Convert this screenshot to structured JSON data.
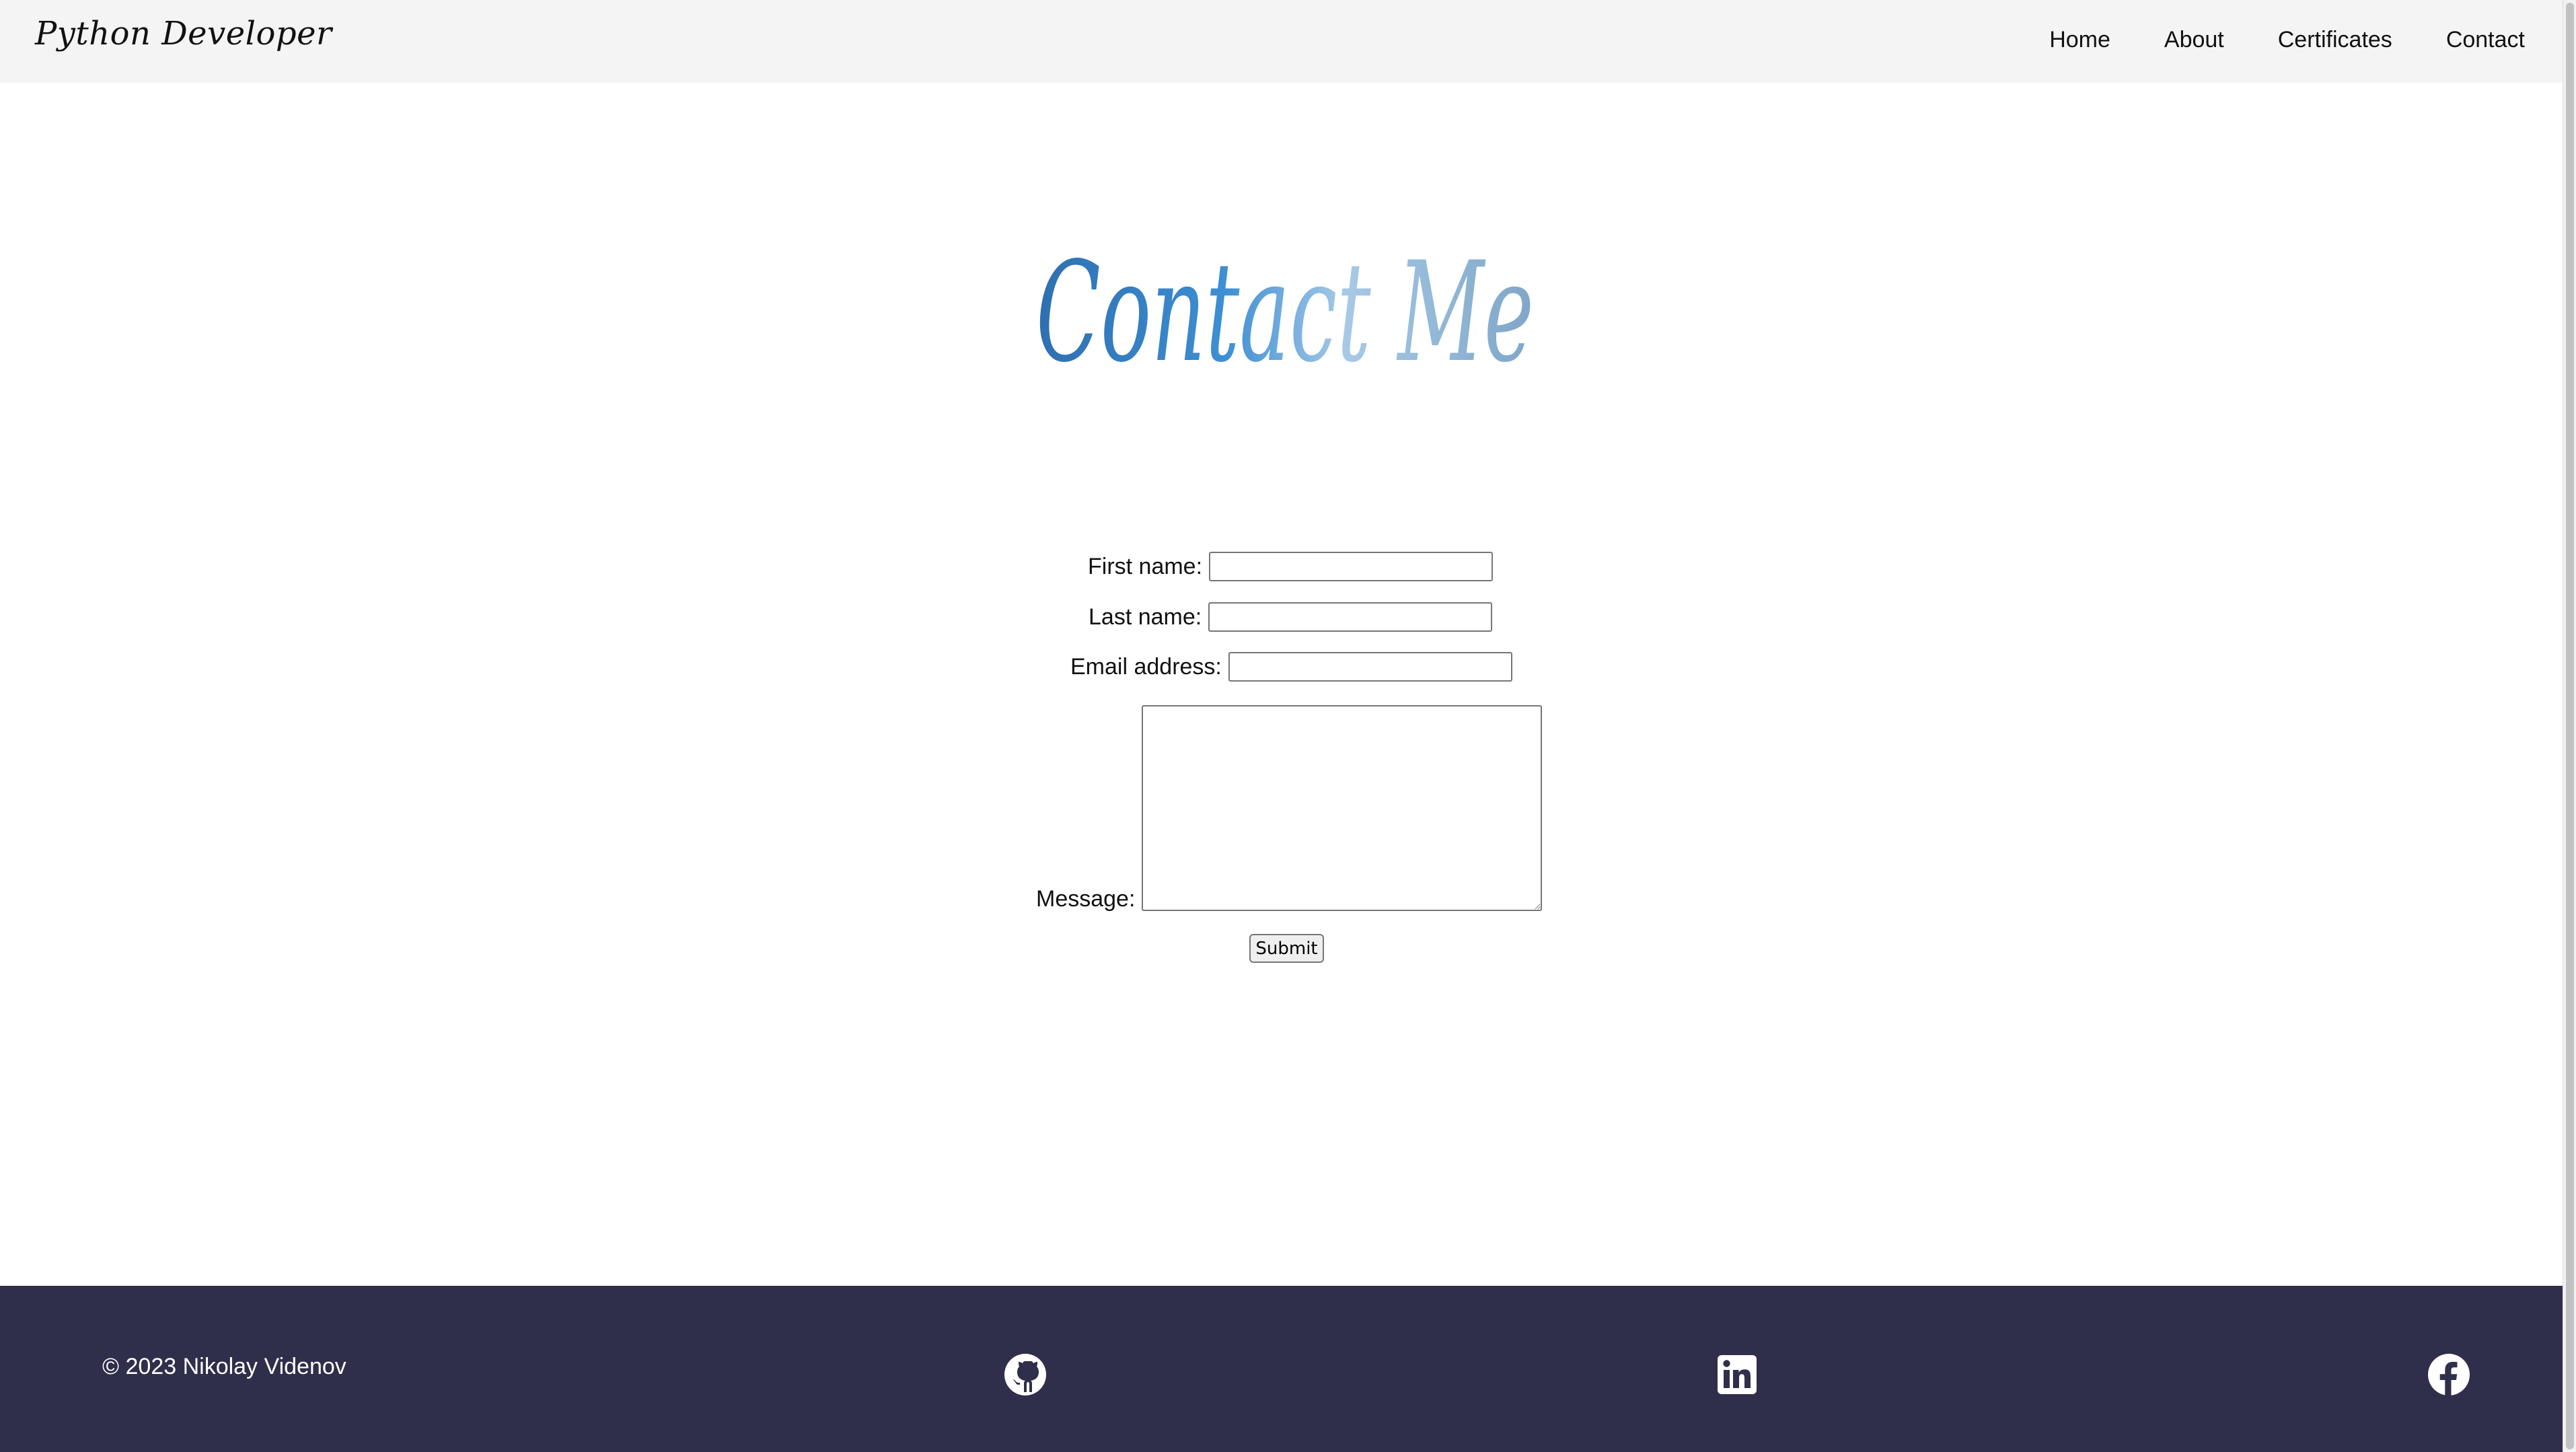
{
  "navbar": {
    "brand": "Python Developer",
    "links": [
      "Home",
      "About",
      "Certificates",
      "Contact"
    ]
  },
  "heading": {
    "text": "Contact Me",
    "colors": [
      "#2e6fb0",
      "#3d8fd4",
      "#9cc3e4",
      "#7aa3c6"
    ]
  },
  "form": {
    "first_name_label": "First name:",
    "last_name_label": "Last name:",
    "email_label": "Email address:",
    "message_label": "Message:",
    "first_name_value": "",
    "last_name_value": "",
    "email_value": "",
    "message_value": "",
    "submit_label": "Submit"
  },
  "footer": {
    "copyright": "© 2023 Nikolay Videnov",
    "icons": [
      "github-icon",
      "linkedin-icon",
      "facebook-icon"
    ],
    "background": "#2f2e4b"
  }
}
